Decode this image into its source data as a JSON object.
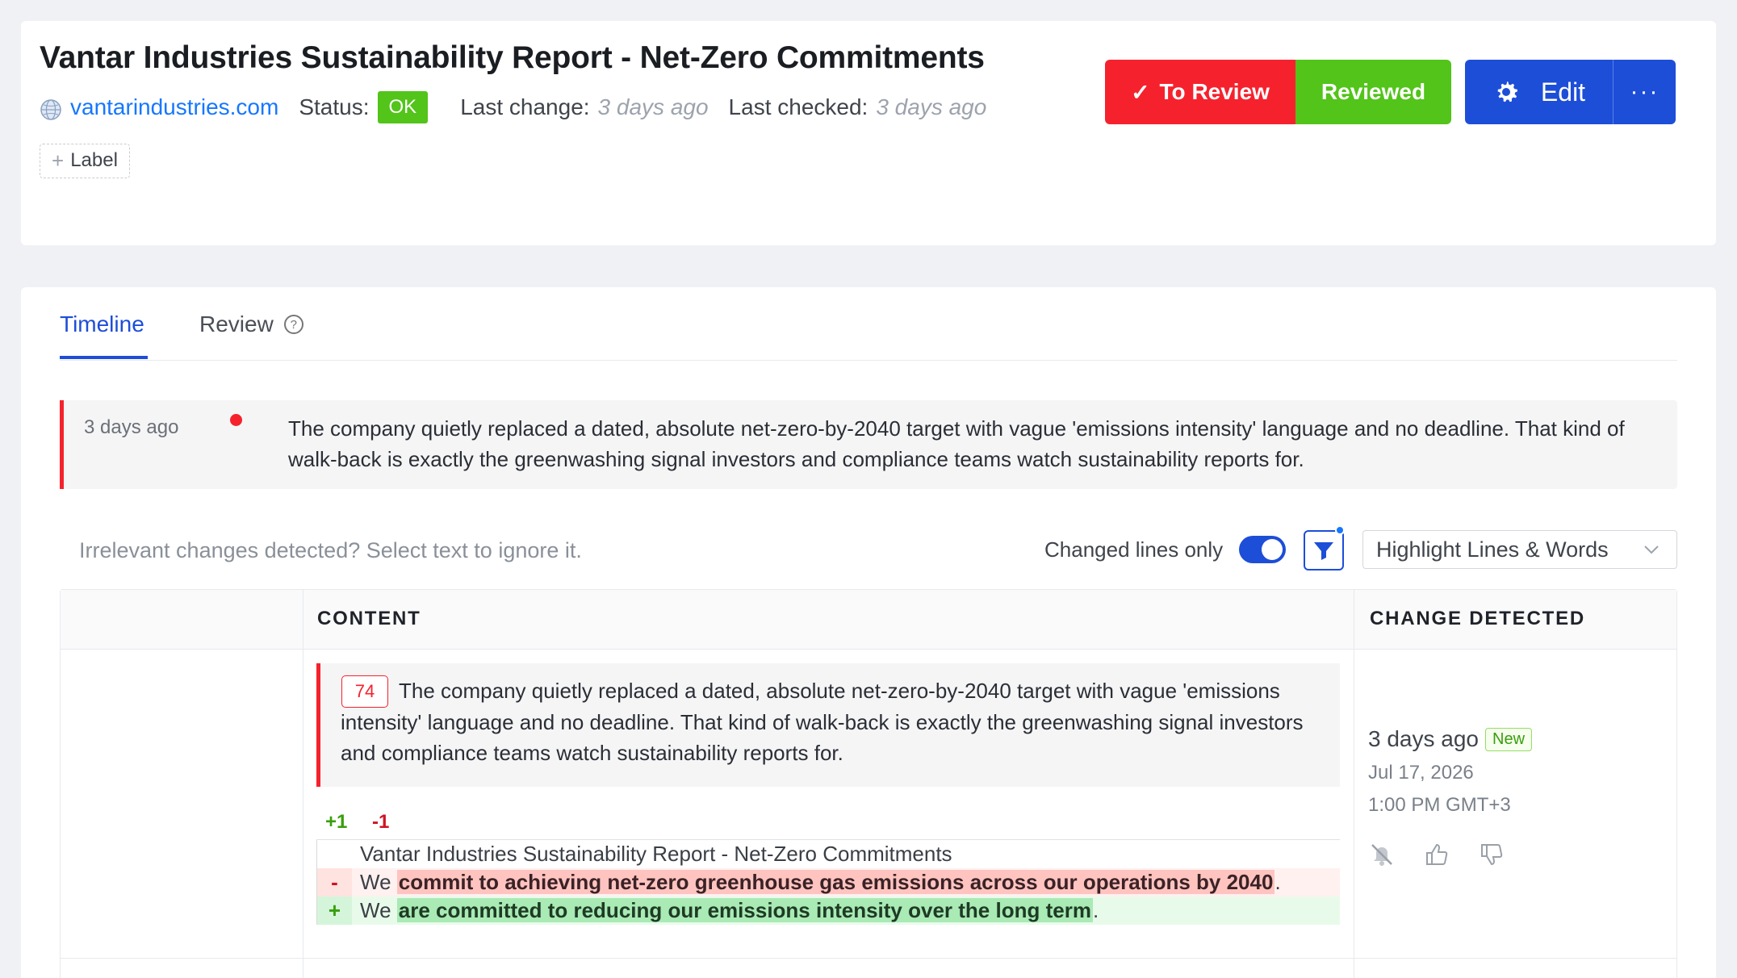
{
  "header": {
    "title": "Vantar Industries Sustainability Report - Net-Zero Commitments",
    "site": "vantarindustries.com",
    "status_label": "Status:",
    "status_value": "OK",
    "last_change_label": "Last change:",
    "last_change_value": "3 days ago",
    "last_checked_label": "Last checked:",
    "last_checked_value": "3 days ago",
    "add_label": "Label",
    "to_review_label": "To Review",
    "reviewed_label": "Reviewed",
    "edit_label": "Edit",
    "more_label": "···"
  },
  "tabs": [
    {
      "label": "Timeline",
      "active": true
    },
    {
      "label": "Review",
      "active": false
    }
  ],
  "summary": {
    "time": "3 days ago",
    "text": "The company quietly replaced a dated, absolute net-zero-by-2040 target with vague 'emissions intensity' language and no deadline. That kind of walk-back is exactly the greenwashing signal investors and compliance teams watch sustainability reports for."
  },
  "toolbar": {
    "hint": "Irrelevant changes detected? Select text to ignore it.",
    "changed_lines_label": "Changed lines only",
    "changed_lines_on": true,
    "highlight_mode": "Highlight Lines & Words"
  },
  "table": {
    "headers": {
      "content": "CONTENT",
      "change": "CHANGE DETECTED"
    },
    "row": {
      "score": "74",
      "summary": "The company quietly replaced a dated, absolute net-zero-by-2040 target with vague 'emissions intensity' language and no deadline. That kind of walk-back is exactly the greenwashing signal investors and compliance teams watch sustainability reports for.",
      "added_count": "+1",
      "removed_count": "-1",
      "diff": {
        "context": "Vantar Industries Sustainability Report - Net-Zero Commitments",
        "del_marker": "-",
        "del_prefix": "We",
        "del_highlight": "commit to achieving net-zero greenhouse gas emissions across our operations by 2040",
        "del_suffix": ".",
        "add_marker": "+",
        "add_prefix": "We",
        "add_highlight": "are committed to reducing our emissions intensity over the long term",
        "add_suffix": "."
      },
      "change_relative": "3 days ago",
      "new_badge": "New",
      "change_date": "Jul 17, 2026",
      "change_time": "1:00 PM GMT+3"
    }
  },
  "colors": {
    "accent": "#1d4ed8",
    "danger": "#f5222d",
    "success": "#52c41a",
    "link": "#1677ff"
  }
}
